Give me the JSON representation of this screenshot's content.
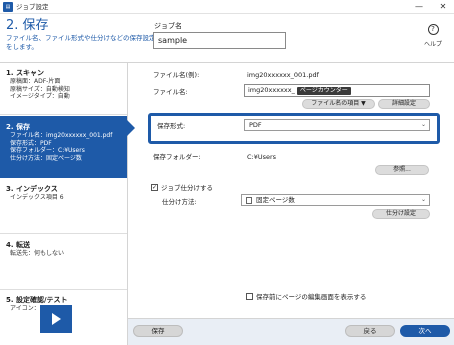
{
  "window": {
    "title": "ジョブ設定",
    "minimize_glyph": "—",
    "close_glyph": "✕"
  },
  "header": {
    "page_title": "2. 保存",
    "description": "ファイル名、ファイル形式や仕分けなどの保存設定をします。",
    "job_name_label": "ジョブ名",
    "job_name_value": "sample",
    "help_glyph": "?",
    "help_label": "ヘルプ"
  },
  "sidebar": {
    "steps": [
      {
        "title": "1. スキャン",
        "details": [
          "原稿面：ADF-片面",
          "原稿サイズ：自動検知",
          "イメージタイプ：自動"
        ]
      },
      {
        "title": "2. 保存",
        "details": [
          "ファイル名：img20xxxxxx_001.pdf",
          "保存形式：PDF",
          "保存フォルダー：C:¥Users",
          "仕分け方法：固定ページ数"
        ]
      },
      {
        "title": "3. インデックス",
        "details": [
          "インデックス項目 6"
        ]
      },
      {
        "title": "4. 転送",
        "details": [
          "転送先：何もしない"
        ]
      },
      {
        "title": "5. 設定確認/テスト",
        "details": [
          "アイコン："
        ]
      }
    ]
  },
  "main": {
    "filename_example_label": "ファイル名(例):",
    "filename_example_value": "img20xxxxxx_001.pdf",
    "filename_label": "ファイル名:",
    "filename_value": "img20xxxxxx_",
    "filename_counter": "ページカウンター",
    "filename_items_button": "ファイル名の項目 ▼",
    "detail_settings_button": "詳細設定",
    "format_label": "保存形式:",
    "format_value": "PDF",
    "folder_label": "保存フォルダー:",
    "folder_value": "C:¥Users",
    "browse_button": "参照...",
    "split_checkbox_label": "ジョブ仕分けする",
    "split_method_label": "仕分け方法:",
    "split_method_value": "固定ページ数",
    "split_settings_button": "仕分け設定",
    "show_edit_screen_label": "保存前にページの編集画面を表示する"
  },
  "footer": {
    "save_button": "保存",
    "back_button": "戻る",
    "next_button": "次へ"
  },
  "colors": {
    "accent": "#1e5aa8",
    "footer_bg": "#e9eef5"
  }
}
